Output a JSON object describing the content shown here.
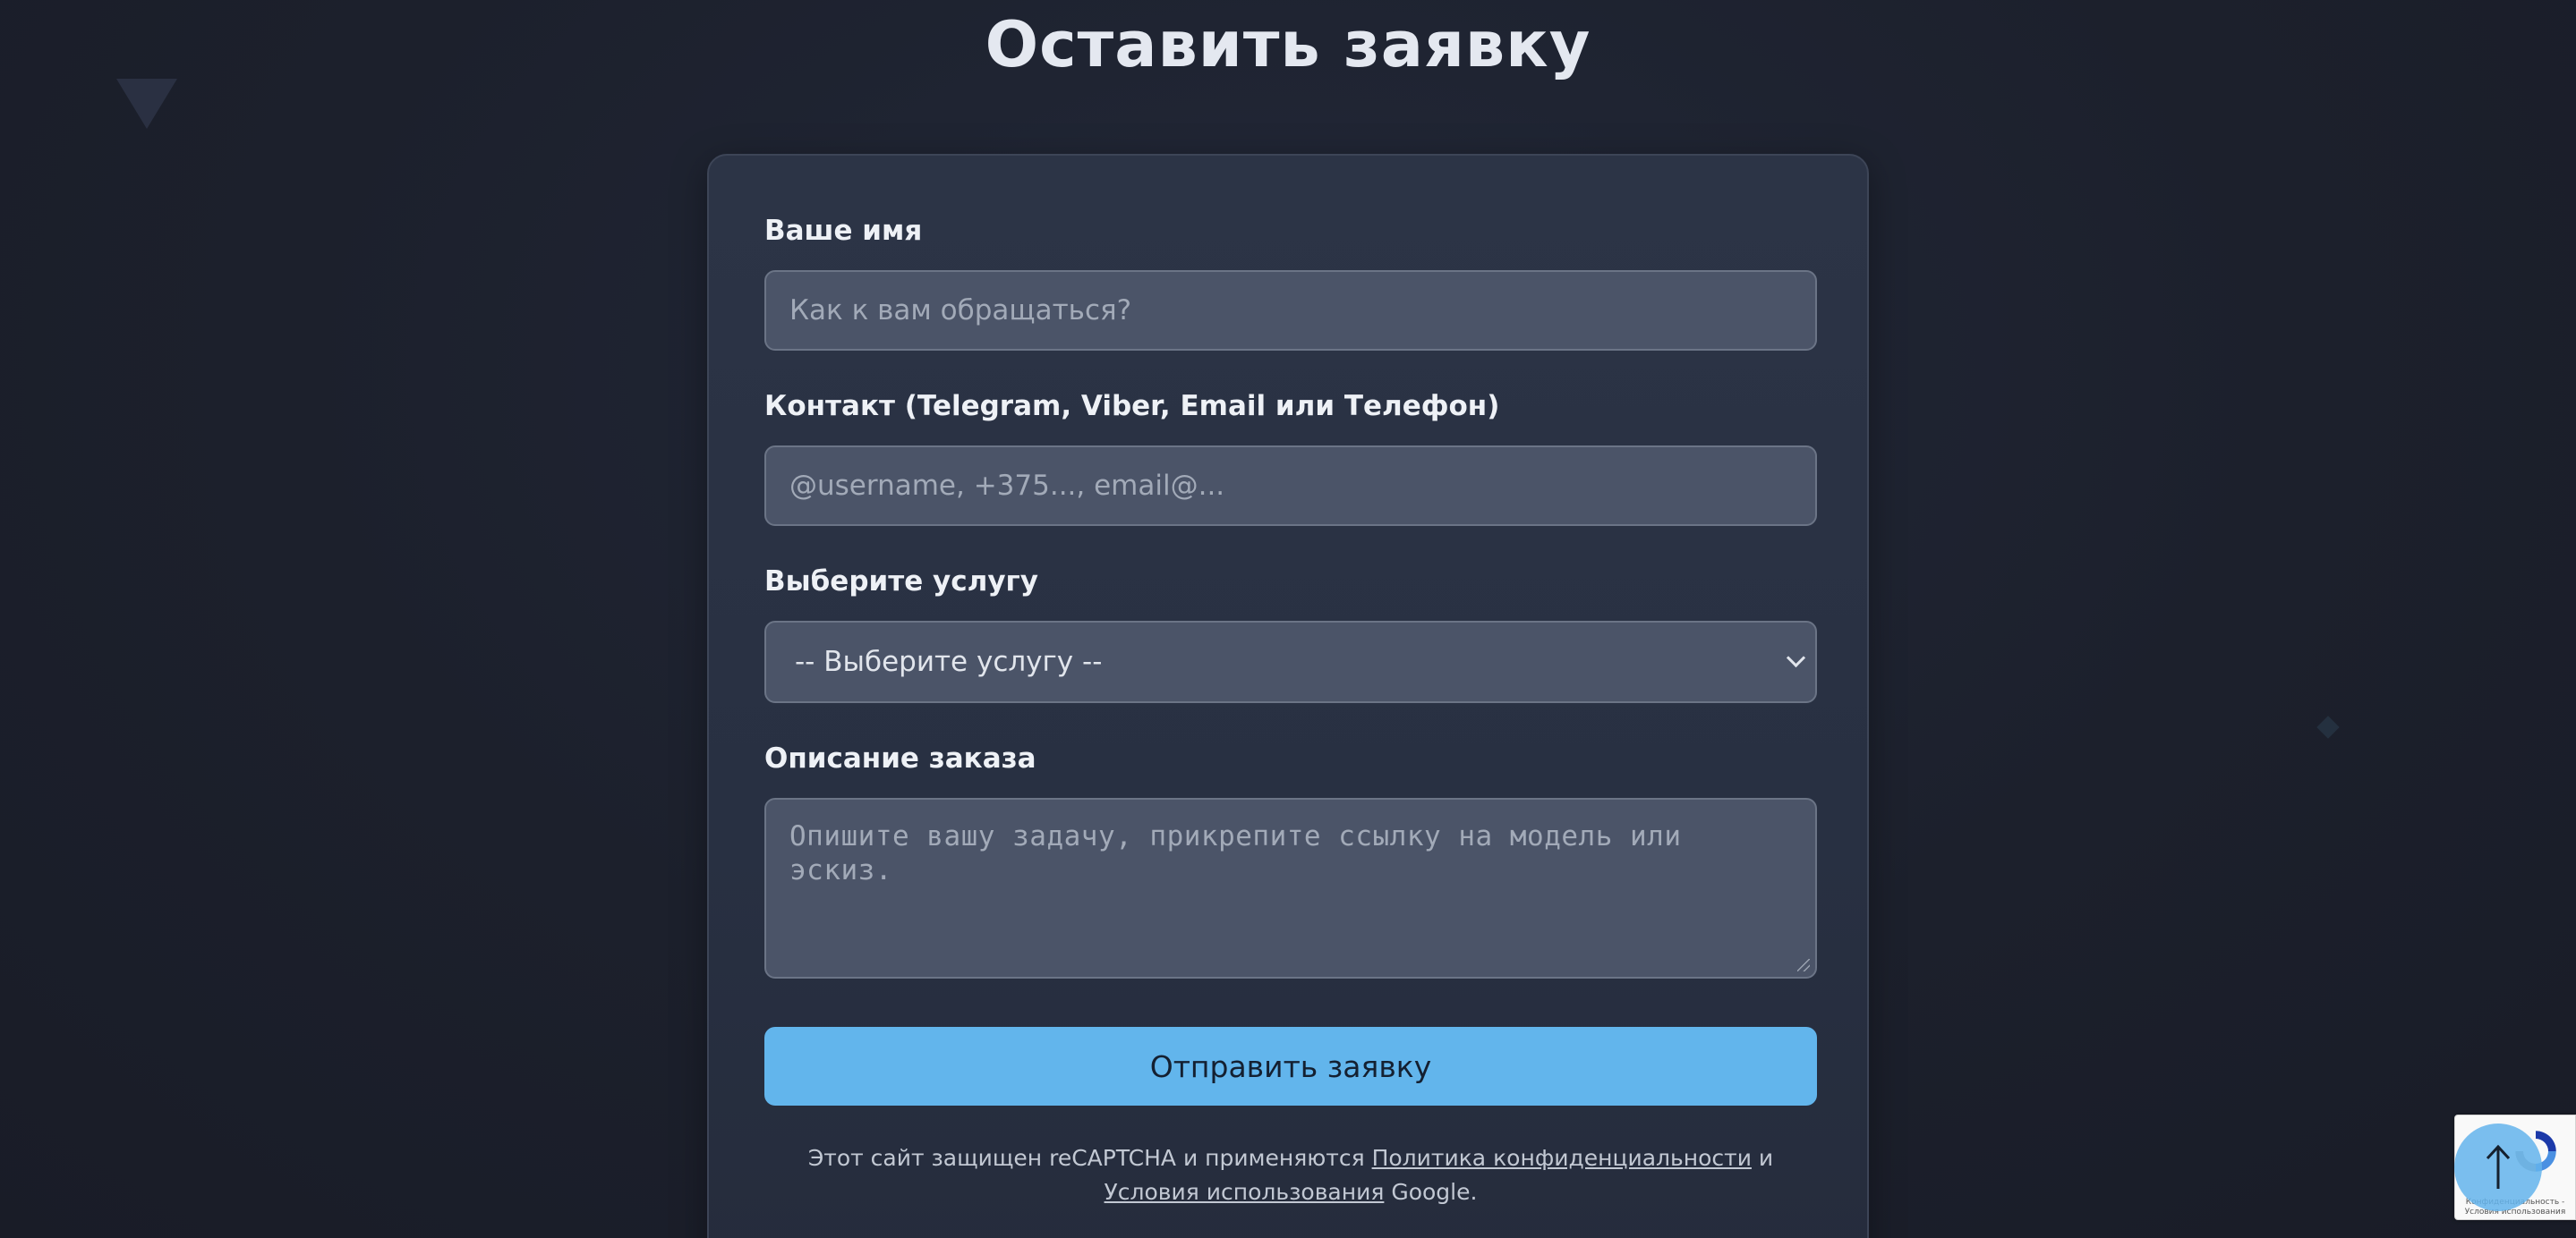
{
  "page": {
    "heading": "Оставить заявку"
  },
  "form": {
    "name_label": "Ваше имя",
    "name_placeholder": "Как к вам обращаться?",
    "contact_label": "Контакт (Telegram, Viber, Email или Телефон)",
    "contact_placeholder": "@username, +375..., email@...",
    "service_label": "Выберите услугу",
    "service_selected": "-- Выберите услугу --",
    "description_label": "Описание заказа",
    "description_placeholder": "Опишите вашу задачу, прикрепите ссылку на модель или эскиз.",
    "submit_label": "Отправить заявку"
  },
  "legal": {
    "text_before": "Этот сайт защищен reCAPTCHA и применяются ",
    "privacy_link": "Политика конфиденциальности",
    "conjunction": " и ",
    "terms_link": "Условия использования",
    "text_after": " Google."
  },
  "recaptcha_badge": {
    "text_line_1": "Конфиденциальность -",
    "text_line_2": "Условия использования"
  },
  "colors": {
    "background": "#1b1f2b",
    "card": "#2c3446",
    "field": "#4b5468",
    "accent": "#62b5ec",
    "heading": "#e4e8f0"
  },
  "icons": {
    "select_chevron": "chevron-down-icon",
    "scroll_top": "arrow-up-icon",
    "recaptcha": "recaptcha-logo-icon"
  }
}
